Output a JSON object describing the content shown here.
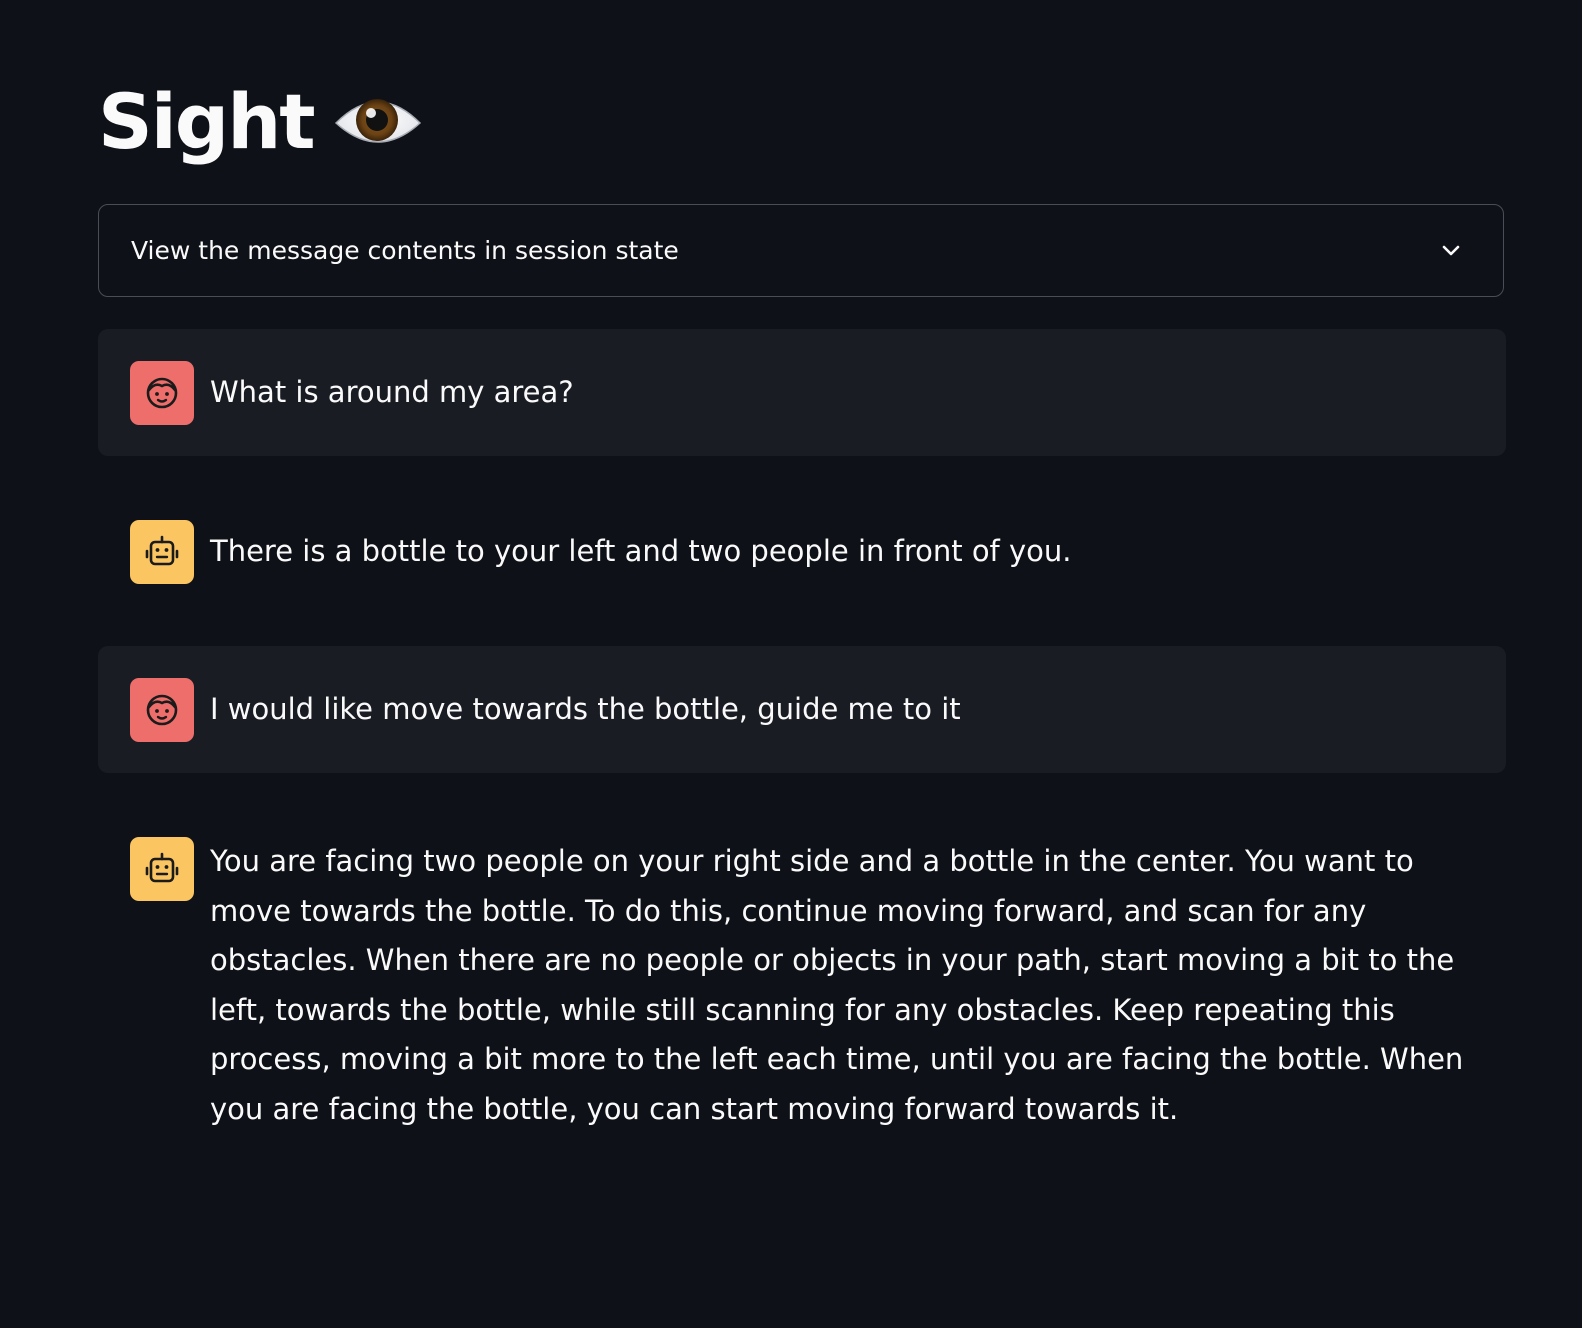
{
  "app": {
    "title": "Sight",
    "title_icon": "eye-emoji"
  },
  "expander": {
    "label": "View the message contents in session state",
    "icon": "chevron-down-icon"
  },
  "messages": [
    {
      "role": "user",
      "avatar_icon": "face-icon",
      "text": "What is around my area?"
    },
    {
      "role": "assistant",
      "avatar_icon": "robot-icon",
      "text": "There is a bottle to your left and two people in front of you."
    },
    {
      "role": "user",
      "avatar_icon": "face-icon",
      "text": "I would like move towards the bottle, guide me to it"
    },
    {
      "role": "assistant",
      "avatar_icon": "robot-icon",
      "text": "You are facing two people on your right side and a bottle in the center. You want to move towards the bottle. To do this, continue moving forward, and scan for any obstacles. When there are no people or objects in your path, start moving a bit to the left, towards the bottle, while still scanning for any obstacles. Keep repeating this process, moving a bit more to the left each time, until you are facing the bottle. When you are facing the bottle, you can start moving forward towards it."
    }
  ],
  "colors": {
    "background": "#0e1117",
    "user_message_bg": "#1a1c24",
    "user_avatar": "#ee6e6b",
    "assistant_avatar": "#fbc561",
    "text": "#fafafa"
  }
}
